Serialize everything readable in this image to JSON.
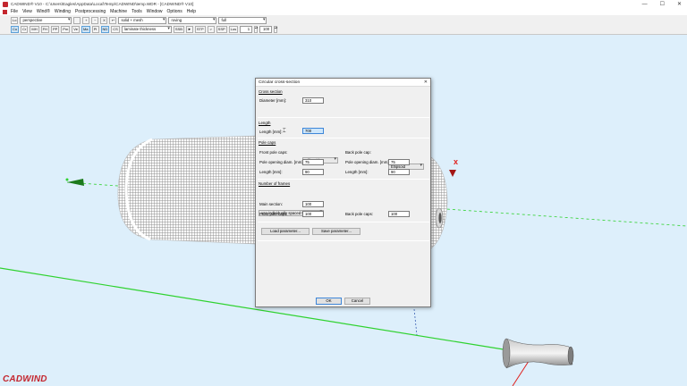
{
  "window": {
    "title": "CADWIND® V10 - C:\\Users\\Eagles\\AppData\\Local\\Temp\\CADWIND\\temp.WDR - [CADWIND® V10]",
    "min_glyph": "—",
    "max_glyph": "☐",
    "close_glyph": "✕"
  },
  "menu": [
    "File",
    "View",
    "Wind®",
    "Winding",
    "Postprocessing",
    "Machine",
    "Tools",
    "Window",
    "Options",
    "Help"
  ],
  "toolbar1": {
    "lo_label": "Lo",
    "view_select": "perspective",
    "zoom_in": "+",
    "zoom_out": "−",
    "x_btn": "X",
    "arrow_btn": "↩",
    "render_select": "solid + mesh",
    "mode_select": "roving",
    "range_select": "full"
  },
  "toolbar2": {
    "buttons": [
      "Co",
      "Cr",
      "MH",
      "FH",
      "PP",
      "Pm",
      "Ve",
      "Ma",
      "Pl",
      "ND",
      "CS"
    ],
    "thickness_select": "laminate thickness",
    "right_buttons": [
      "SSB",
      "STP",
      ">",
      "SSP",
      "Los"
    ],
    "step_value": "1",
    "percent_value": "100"
  },
  "logo": "CADWIND",
  "dialog": {
    "title": "Circular cross-section",
    "close": "✕",
    "cross_section": {
      "title": "Cross section",
      "diameter_label": "Diameter [mm]:",
      "diameter_value": "310"
    },
    "length": {
      "title": "Length",
      "length_label": "Length [mm]:",
      "length_value": "700"
    },
    "pole_caps": {
      "title": "Pole caps",
      "front_label": "Front pole caps:",
      "front_value": "Ellipsoid",
      "back_label": "Back pole cap:",
      "back_value": "Ellipsoid",
      "front_opening_label": "Pole opening diam. [mm]:",
      "front_opening_value": "75",
      "back_opening_label": "Pole opening diam. [mm]:",
      "back_opening_value": "75",
      "front_length_label": "Length [mm]:",
      "front_length_value": "90",
      "back_length_label": "Length [mm]:",
      "back_length_value": "90"
    },
    "frames": {
      "title": "Number of frames",
      "mode_value": "use individually spaced frames",
      "main_label": "Main section:",
      "main_value": "100",
      "front_label": "Front pole caps:",
      "front_value": "100",
      "back_label": "Back pole caps:",
      "back_value": "100"
    },
    "load_button": "Load parameter...",
    "save_button": "Save parameter...",
    "ok_button": "OK",
    "cancel_button": "Cancel"
  },
  "colors": {
    "viewport_bg": "#ddeffb",
    "axis_green": "#2fd22f",
    "axis_red": "#e0201c",
    "brand_red": "#c4262e"
  }
}
